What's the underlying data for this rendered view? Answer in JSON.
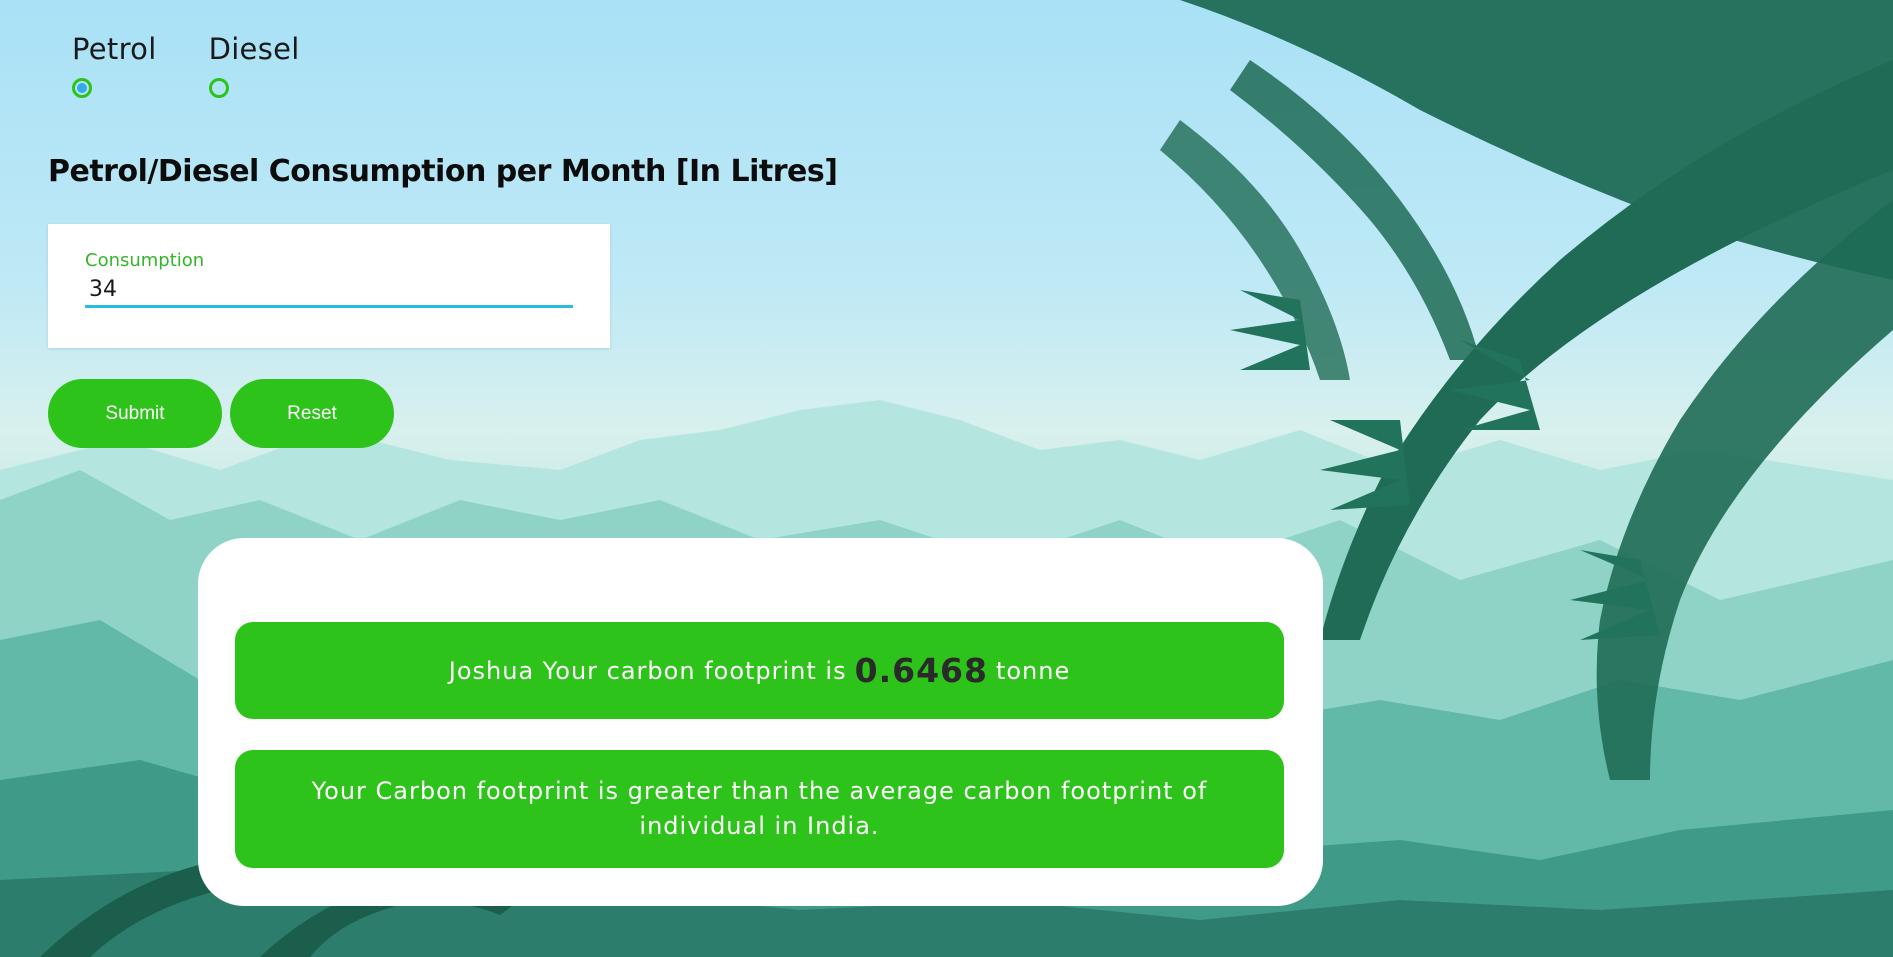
{
  "fuel_selector": {
    "options": [
      {
        "label": "Petrol",
        "selected": true
      },
      {
        "label": "Diesel",
        "selected": false
      }
    ]
  },
  "form": {
    "title": "Petrol/Diesel Consumption per Month [In Litres]",
    "consumption_label": "Consumption",
    "consumption_value": "34"
  },
  "buttons": {
    "submit": "Submit",
    "reset": "Reset"
  },
  "result": {
    "prefix": "Joshua Your carbon footprint is",
    "value": "0.6468",
    "unit": "tonne",
    "comparison": "Your Carbon footprint is greater than the average carbon footprint of individual in India."
  },
  "colors": {
    "accent_green": "#2ec31a",
    "input_underline": "#29bde0",
    "radio_dot": "#36a9e8",
    "sky": "#a9e1f6",
    "fern": "#1f6b55"
  }
}
